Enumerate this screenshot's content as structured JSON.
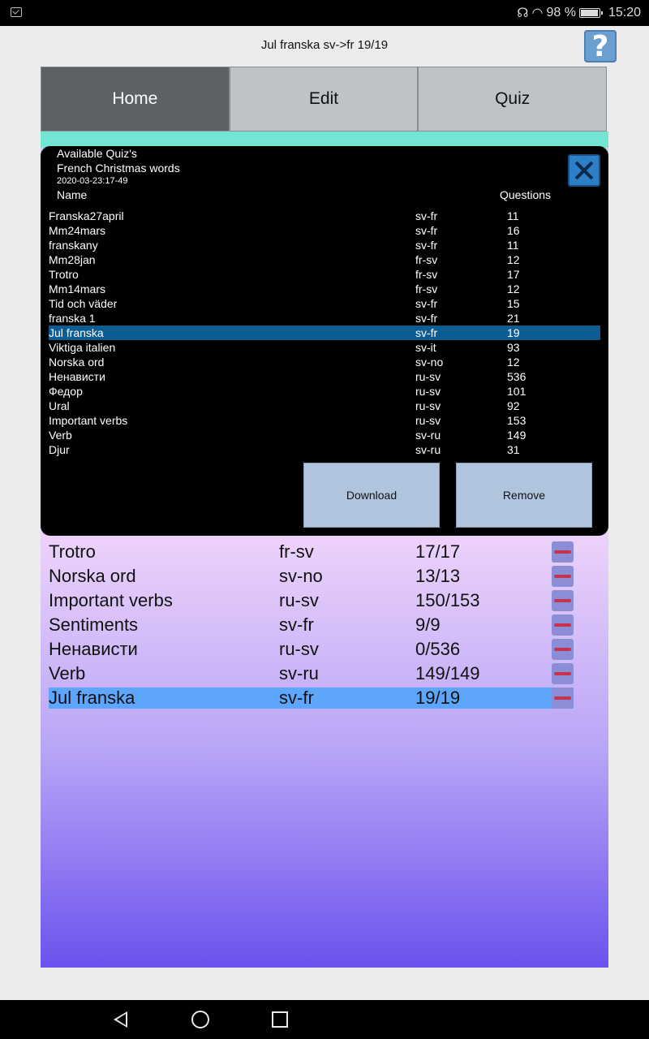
{
  "status_bar": {
    "battery": "98 %",
    "time": "15:20"
  },
  "header": {
    "title": "Jul franska sv->fr 19/19",
    "help_label": "?"
  },
  "tabs": [
    {
      "label": "Home",
      "active": true
    },
    {
      "label": "Edit",
      "active": false
    },
    {
      "label": "Quiz",
      "active": false
    }
  ],
  "dialog": {
    "title": "Available Quiz's",
    "subtitle": "French Christmas words",
    "date": "2020-03-23:17-49",
    "col_name": "Name",
    "col_questions": "Questions",
    "rows": [
      {
        "name": "Franska27april",
        "lang": "sv-fr",
        "questions": "11"
      },
      {
        "name": "Mm24mars",
        "lang": "sv-fr",
        "questions": "16"
      },
      {
        "name": "franskany",
        "lang": "sv-fr",
        "questions": "11"
      },
      {
        "name": "Mm28jan",
        "lang": "fr-sv",
        "questions": "12"
      },
      {
        "name": "Trotro",
        "lang": "fr-sv",
        "questions": "17"
      },
      {
        "name": "Mm14mars",
        "lang": "fr-sv",
        "questions": "12"
      },
      {
        "name": "Tid och väder",
        "lang": "sv-fr",
        "questions": "15"
      },
      {
        "name": "franska 1",
        "lang": "sv-fr",
        "questions": "21"
      },
      {
        "name": "Jul franska",
        "lang": "sv-fr",
        "questions": "19",
        "selected": true
      },
      {
        "name": "Viktiga italien",
        "lang": "sv-it",
        "questions": "93"
      },
      {
        "name": "Norska ord",
        "lang": "sv-no",
        "questions": "12"
      },
      {
        "name": "Ненависти",
        "lang": "ru-sv",
        "questions": "536"
      },
      {
        "name": "Федор",
        "lang": "ru-sv",
        "questions": "101"
      },
      {
        "name": "Ural",
        "lang": "ru-sv",
        "questions": "92"
      },
      {
        "name": "Important verbs",
        "lang": "ru-sv",
        "questions": "153"
      },
      {
        "name": "Verb",
        "lang": "sv-ru",
        "questions": "149"
      },
      {
        "name": "Djur",
        "lang": "sv-ru",
        "questions": "31"
      }
    ],
    "download_label": "Download",
    "remove_label": "Remove"
  },
  "my_quizzes": [
    {
      "name": "Trotro",
      "lang": "fr-sv",
      "score": "17/17"
    },
    {
      "name": "Norska ord",
      "lang": "sv-no",
      "score": "13/13"
    },
    {
      "name": "Important verbs",
      "lang": "ru-sv",
      "score": "150/153"
    },
    {
      "name": "Sentiments",
      "lang": "sv-fr",
      "score": "9/9"
    },
    {
      "name": "Ненависти",
      "lang": "ru-sv",
      "score": "0/536"
    },
    {
      "name": "Verb",
      "lang": "sv-ru",
      "score": "149/149"
    },
    {
      "name": "Jul franska",
      "lang": "sv-fr",
      "score": "19/19",
      "selected": true
    }
  ],
  "colors": {
    "accent": "#5ea6fb",
    "dialog_selected": "#0d5c92",
    "tab_active": "#5c6166",
    "remove_dash": "#c8324a"
  }
}
